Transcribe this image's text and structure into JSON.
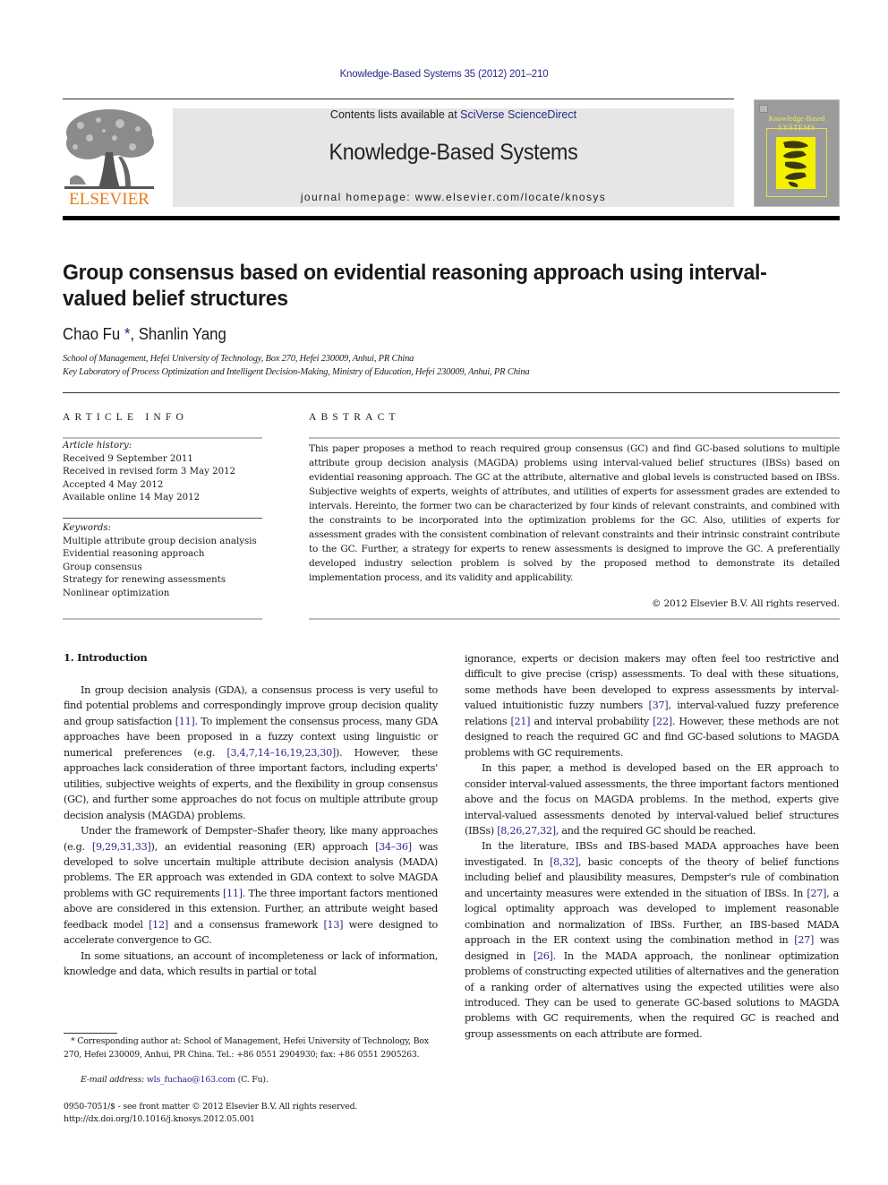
{
  "header": {
    "journal_ref": "Knowledge-Based Systems 35 (2012) 201–210",
    "contents_prefix": "Contents lists available at ",
    "contents_link": "SciVerse ScienceDirect",
    "journal_title": "Knowledge-Based Systems",
    "homepage": "journal homepage: www.elsevier.com/locate/knosys",
    "publisher_wordmark": "ELSEVIER",
    "cover": {
      "title_line1": "Knowledge-Based",
      "title_line2": "SYSTEMS"
    },
    "colors": {
      "link": "#2a2a8a",
      "elsevier_orange": "#e87b1e",
      "banner_bg": "#e6e6e6",
      "cover_bg": "#9b9b9b",
      "cover_accent": "#f4f000"
    }
  },
  "article": {
    "title": "Group consensus based on evidential reasoning approach using interval-valued belief structures",
    "authors": [
      {
        "name": "Chao Fu",
        "mark": "*"
      },
      {
        "name": "Shanlin Yang",
        "mark": ""
      }
    ],
    "author_separator": ", ",
    "affiliations": [
      "School of Management, Hefei University of Technology, Box 270, Hefei 230009, Anhui, PR China",
      "Key Laboratory of Process Optimization and Intelligent Decision-Making, Ministry of Education, Hefei 230009, Anhui, PR China"
    ]
  },
  "article_info": {
    "label": "ARTICLE INFO",
    "history_heading": "Article history:",
    "history": [
      "Received 9 September 2011",
      "Received in revised form 3 May 2012",
      "Accepted 4 May 2012",
      "Available online 14 May 2012"
    ],
    "keywords_heading": "Keywords:",
    "keywords": [
      "Multiple attribute group decision analysis",
      "Evidential reasoning approach",
      "Group consensus",
      "Strategy for renewing assessments",
      "Nonlinear optimization"
    ]
  },
  "abstract": {
    "label": "ABSTRACT",
    "text": "This paper proposes a method to reach required group consensus (GC) and find GC-based solutions to multiple attribute group decision analysis (MAGDA) problems using interval-valued belief structures (IBSs) based on evidential reasoning approach. The GC at the attribute, alternative and global levels is constructed based on IBSs. Subjective weights of experts, weights of attributes, and utilities of experts for assessment grades are extended to intervals. Hereinto, the former two can be characterized by four kinds of relevant constraints, and combined with the constraints to be incorporated into the optimization problems for the GC. Also, utilities of experts for assessment grades with the consistent combination of relevant constraints and their intrinsic constraint contribute to the GC. Further, a strategy for experts to renew assessments is designed to improve the GC. A preferentially developed industry selection problem is solved by the proposed method to demonstrate its detailed implementation process, and its validity and applicability.",
    "copyright": "© 2012 Elsevier B.V. All rights reserved."
  },
  "body": {
    "section_heading": "1. Introduction",
    "left_paragraphs": [
      [
        {
          "t": "In group decision analysis (GDA), a consensus process is very useful to find potential problems and correspondingly improve group decision quality and group satisfaction "
        },
        {
          "ref": "[11]"
        },
        {
          "t": ". To implement the consensus process, many GDA approaches have been proposed in a fuzzy context using linguistic or numerical preferences (e.g. "
        },
        {
          "ref": "[3,4,7,14–16,19,23,30]"
        },
        {
          "t": "). However, these approaches lack consideration of three important factors, including experts' utilities, subjective weights of experts, and the flexibility in group consensus (GC), and further some approaches do not focus on multiple attribute group decision analysis (MAGDA) problems."
        }
      ],
      [
        {
          "t": "Under the framework of Dempster–Shafer theory, like many approaches (e.g. "
        },
        {
          "ref": "[9,29,31,33]"
        },
        {
          "t": "), an evidential reasoning (ER) approach "
        },
        {
          "ref": "[34–36]"
        },
        {
          "t": " was developed to solve uncertain multiple attribute decision analysis (MADA) problems. The ER approach was extended in GDA context to solve MAGDA problems with GC requirements "
        },
        {
          "ref": "[11]"
        },
        {
          "t": ". The three important factors mentioned above are considered in this extension. Further, an attribute weight based feedback model "
        },
        {
          "ref": "[12]"
        },
        {
          "t": " and a consensus framework "
        },
        {
          "ref": "[13]"
        },
        {
          "t": " were designed to accelerate convergence to GC."
        }
      ],
      [
        {
          "t": "In some situations, an account of incompleteness or lack of information, knowledge and data, which results in partial or total"
        }
      ]
    ],
    "right_paragraphs": [
      [
        {
          "t": "ignorance, experts or decision makers may often feel too restrictive and difficult to give precise (crisp) assessments. To deal with these situations, some methods have been developed to express assessments by interval-valued intuitionistic fuzzy numbers "
        },
        {
          "ref": "[37]"
        },
        {
          "t": ", interval-valued fuzzy preference relations "
        },
        {
          "ref": "[21]"
        },
        {
          "t": " and interval probability "
        },
        {
          "ref": "[22]"
        },
        {
          "t": ". However, these methods are not designed to reach the required GC and find GC-based solutions to MAGDA problems with GC requirements."
        }
      ],
      [
        {
          "t": "In this paper, a method is developed based on the ER approach to consider interval-valued assessments, the three important factors mentioned above and the focus on MAGDA problems. In the method, experts give interval-valued assessments denoted by interval-valued belief structures (IBSs) "
        },
        {
          "ref": "[8,26,27,32]"
        },
        {
          "t": ", and the required GC should be reached."
        }
      ],
      [
        {
          "t": "In the literature, IBSs and IBS-based MADA approaches have been investigated. In "
        },
        {
          "ref": "[8,32]"
        },
        {
          "t": ", basic concepts of the theory of belief functions including belief and plausibility measures, Dempster's rule of combination and uncertainty measures were extended in the situation of IBSs. In "
        },
        {
          "ref": "[27]"
        },
        {
          "t": ", a logical optimality approach was developed to implement reasonable combination and normalization of IBSs. Further, an IBS-based MADA approach in the ER context using the combination method in "
        },
        {
          "ref": "[27]"
        },
        {
          "t": " was designed in "
        },
        {
          "ref": "[26]"
        },
        {
          "t": ". In the MADA approach, the nonlinear optimization problems of constructing expected utilities of alternatives and the generation of a ranking order of alternatives using the expected utilities were also introduced. They can be used to generate GC-based solutions to MAGDA problems with GC requirements, when the required GC is reached and group assessments on each attribute are formed."
        }
      ]
    ]
  },
  "footnotes": {
    "corresponding": "* Corresponding author at: School of Management, Hefei University of Technology, Box 270, Hefei 230009, Anhui, PR China. Tel.: +86 0551 2904930; fax: +86 0551 2905263.",
    "email_label": "E-mail address: ",
    "email": "wls_fuchao@163.com",
    "email_suffix": " (C. Fu).",
    "issn": "0950-7051/$ - see front matter © 2012 Elsevier B.V. All rights reserved.",
    "doi": "http://dx.doi.org/10.1016/j.knosys.2012.05.001"
  }
}
